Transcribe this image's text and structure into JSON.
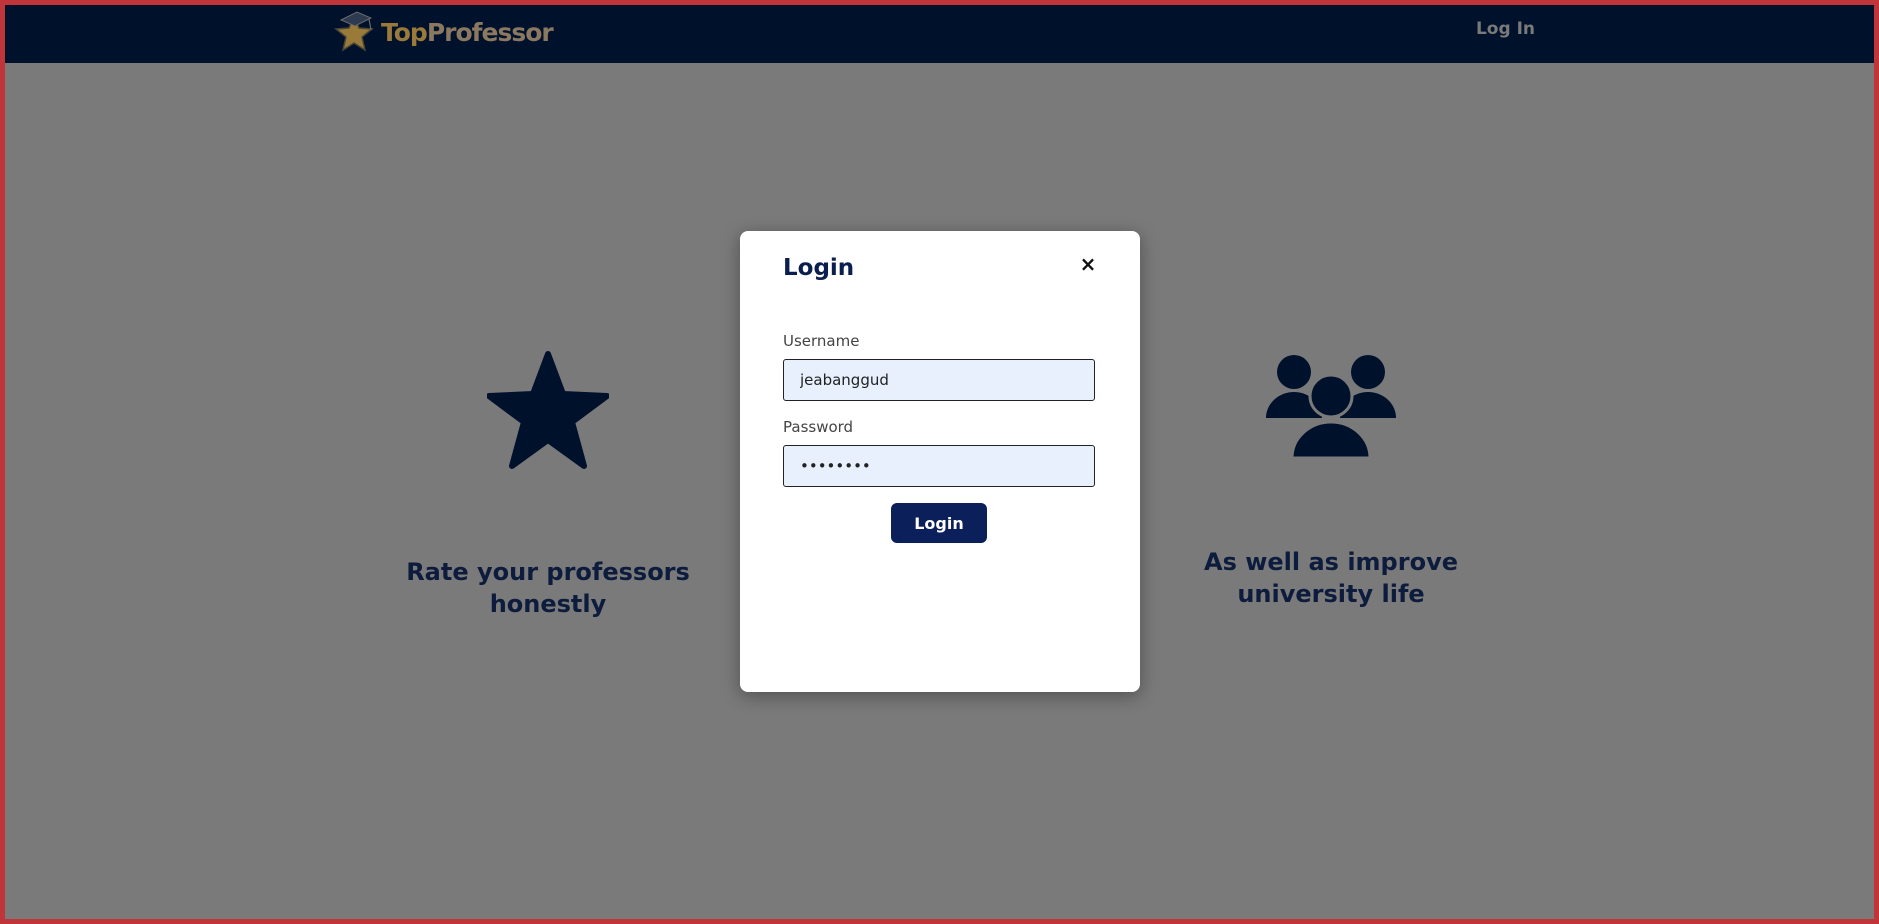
{
  "navbar": {
    "brand_top": "Top",
    "brand_professor": "Professor",
    "login_link": "Log In"
  },
  "features": [
    {
      "icon": "star-icon",
      "title_line1": "Rate your professors",
      "title_line2": "honestly"
    },
    {
      "icon": "users-group-icon",
      "title_line1": "As well as improve",
      "title_line2": "university life"
    }
  ],
  "modal": {
    "title": "Login",
    "close_label": "×",
    "username_label": "Username",
    "username_value": "jeabanggud",
    "password_label": "Password",
    "password_value": "••••••••",
    "submit_label": "Login"
  },
  "colors": {
    "navbar_bg": "#00112c",
    "overlay_bg": "#7a7a7a",
    "accent": "#0b1f5a",
    "brand_gold": "#9a7a38",
    "input_bg": "#e8effd",
    "frame_border": "#c0353a"
  }
}
